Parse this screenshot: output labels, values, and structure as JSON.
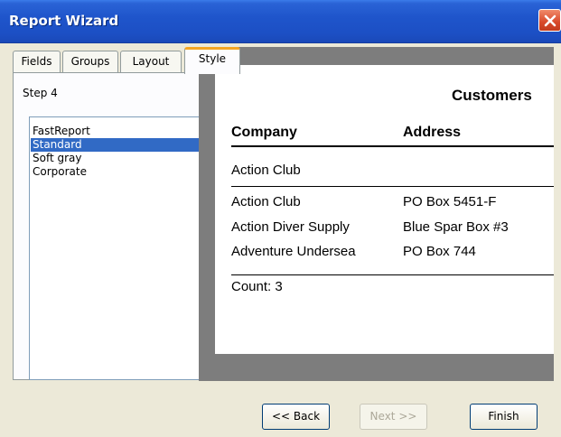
{
  "window": {
    "title": "Report Wizard"
  },
  "tabs": [
    {
      "label": "Fields"
    },
    {
      "label": "Groups"
    },
    {
      "label": "Layout"
    },
    {
      "label": "Style",
      "active": true
    }
  ],
  "step_label": "Step 4",
  "styles": {
    "items": [
      "FastReport",
      "Standard",
      "Soft gray",
      "Corporate"
    ],
    "selected": "Standard"
  },
  "preview": {
    "title": "Customers",
    "headers": {
      "company": "Company",
      "address": "Address"
    },
    "group_header": "Action Club",
    "rows": [
      {
        "company": "Action Club",
        "address": "PO Box 5451-F"
      },
      {
        "company": "Action Diver Supply",
        "address": "Blue Spar Box #3"
      },
      {
        "company": "Adventure Undersea",
        "address": "PO Box 744"
      }
    ],
    "footer": "Count: 3"
  },
  "buttons": {
    "back": "<< Back",
    "next": "Next >>",
    "finish": "Finish"
  },
  "colors": {
    "titlebar": "#1f55cb",
    "selection": "#316ac5",
    "active_tab_accent": "#f5a623"
  },
  "icons": {
    "close": "close-icon"
  }
}
